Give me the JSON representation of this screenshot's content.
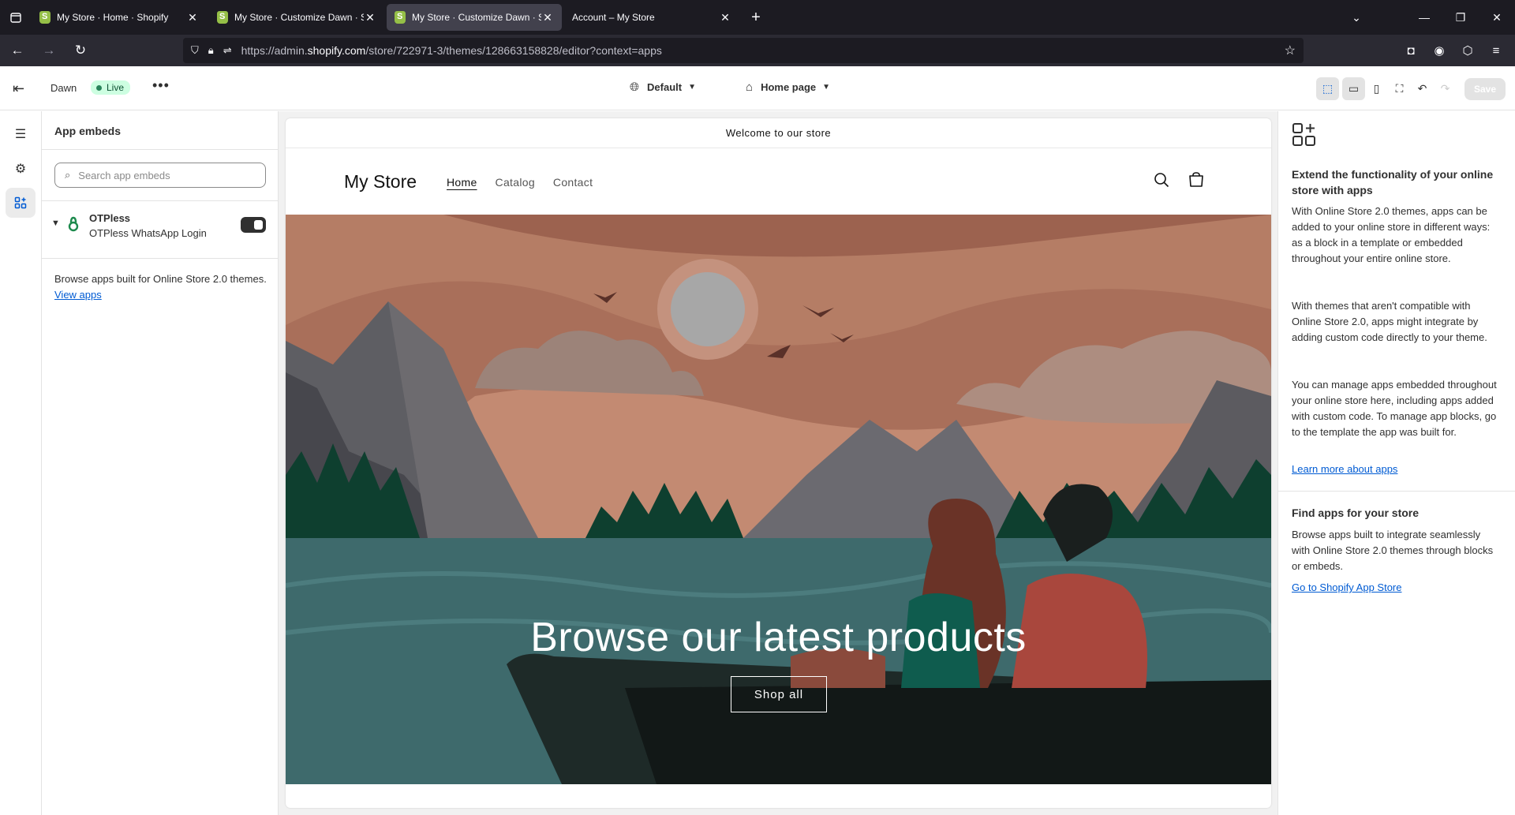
{
  "browser": {
    "tabs": [
      {
        "title": "My Store · Home · Shopify",
        "active": false
      },
      {
        "title": "My Store · Customize Dawn · Sh",
        "active": false
      },
      {
        "title": "My Store · Customize Dawn · Sh",
        "active": true
      },
      {
        "title": "Account – My Store",
        "active": false
      }
    ],
    "url_prefix": "https://admin.",
    "url_domain": "shopify.com",
    "url_path": "/store/722971-3/themes/128663158828/editor?context=apps"
  },
  "editor": {
    "theme_name": "Dawn",
    "live_badge": "Live",
    "market_selector": "Default",
    "page_selector": "Home page",
    "save_label": "Save"
  },
  "sidebar": {
    "title": "App embeds",
    "search_placeholder": "Search app embeds",
    "embed": {
      "app_name": "OTPless",
      "embed_name": "OTPless WhatsApp Login",
      "enabled": true
    },
    "browse_text": "Browse apps built for Online Store 2.0 themes.",
    "view_apps_link": "View apps"
  },
  "preview": {
    "announcement": "Welcome to our store",
    "store_name": "My Store",
    "nav": [
      "Home",
      "Catalog",
      "Contact"
    ],
    "hero_heading": "Browse our latest products",
    "hero_button": "Shop all"
  },
  "right_panel": {
    "heading": "Extend the functionality of your online store with apps",
    "para1": "With Online Store 2.0 themes, apps can be added to your online store in different ways: as a block in a template or embedded throughout your entire online store.",
    "para2": "With themes that aren't compatible with Online Store 2.0, apps might integrate by adding custom code directly to your theme.",
    "para3": "You can manage apps embedded throughout your online store here, including apps added with custom code. To manage app blocks, go to the template the app was built for.",
    "learn_more_link": "Learn more about apps",
    "find_heading": "Find apps for your store",
    "find_text": "Browse apps built to integrate seamlessly with Online Store 2.0 themes through blocks or embeds.",
    "app_store_link": "Go to Shopify App Store"
  },
  "colors": {
    "accent_blue": "#005bd3",
    "live_bg": "#cdfee1",
    "live_dot": "#29845a",
    "browser_dark": "#1c1b22"
  }
}
